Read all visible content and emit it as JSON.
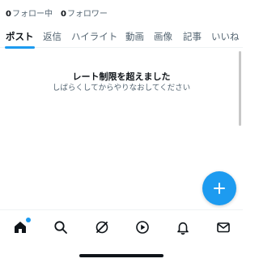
{
  "profile_stats": {
    "following_count": "0",
    "following_label": "フォロー中",
    "followers_count": "0",
    "followers_label": "フォロワー"
  },
  "tabs": [
    {
      "label": "ポスト",
      "active": true
    },
    {
      "label": "返信",
      "active": false
    },
    {
      "label": "ハイライト",
      "active": false
    },
    {
      "label": "動画",
      "active": false
    },
    {
      "label": "画像",
      "active": false
    },
    {
      "label": "記事",
      "active": false
    },
    {
      "label": "いいね",
      "active": false
    }
  ],
  "message": {
    "title": "レート制限を超えました",
    "subtitle": "しばらくしてからやりなおしてください"
  },
  "fab": {
    "icon": "plus-icon"
  },
  "bottom_nav": [
    {
      "icon": "home-icon",
      "has_badge": true
    },
    {
      "icon": "search-icon",
      "has_badge": false
    },
    {
      "icon": "grok-icon",
      "has_badge": false
    },
    {
      "icon": "play-icon",
      "has_badge": false
    },
    {
      "icon": "bell-icon",
      "has_badge": false
    },
    {
      "icon": "mail-icon",
      "has_badge": false
    }
  ],
  "colors": {
    "accent": "#1d9bf0",
    "text_primary": "#0f1419",
    "text_secondary": "#536471",
    "divider": "#eff3f4"
  }
}
